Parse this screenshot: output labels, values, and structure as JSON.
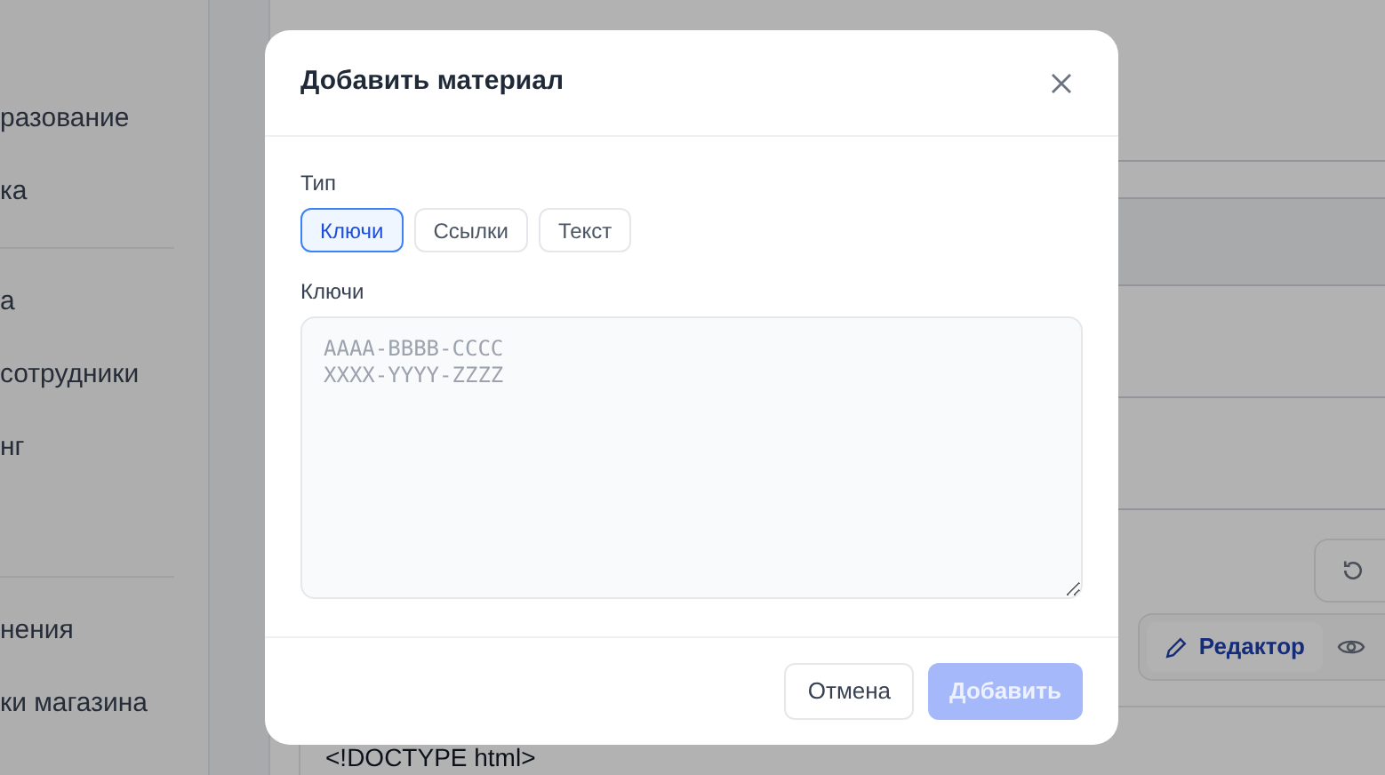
{
  "sidebar": {
    "groups": [
      {
        "items": [
          "разование",
          "ка"
        ]
      },
      {
        "items": [
          "а",
          "сотрудники",
          "нг"
        ]
      },
      {
        "items": [
          "нения",
          "ки магазина"
        ]
      }
    ]
  },
  "editor": {
    "tabs": [
      {
        "label": "Редактор",
        "selected": true
      }
    ],
    "code": "<!DOCTYPE html>"
  },
  "dialog": {
    "title": "Добавить материал",
    "type_label": "Тип",
    "type_options": [
      {
        "label": "Ключи",
        "selected": true
      },
      {
        "label": "Ссылки",
        "selected": false
      },
      {
        "label": "Текст",
        "selected": false
      }
    ],
    "field_label": "Ключи",
    "field_placeholder": "AAAA-BBBB-CCCC\nXXXX-YYYY-ZZZZ",
    "cancel": "Отмена",
    "submit": {
      "label": "Добавить",
      "disabled": true
    }
  }
}
